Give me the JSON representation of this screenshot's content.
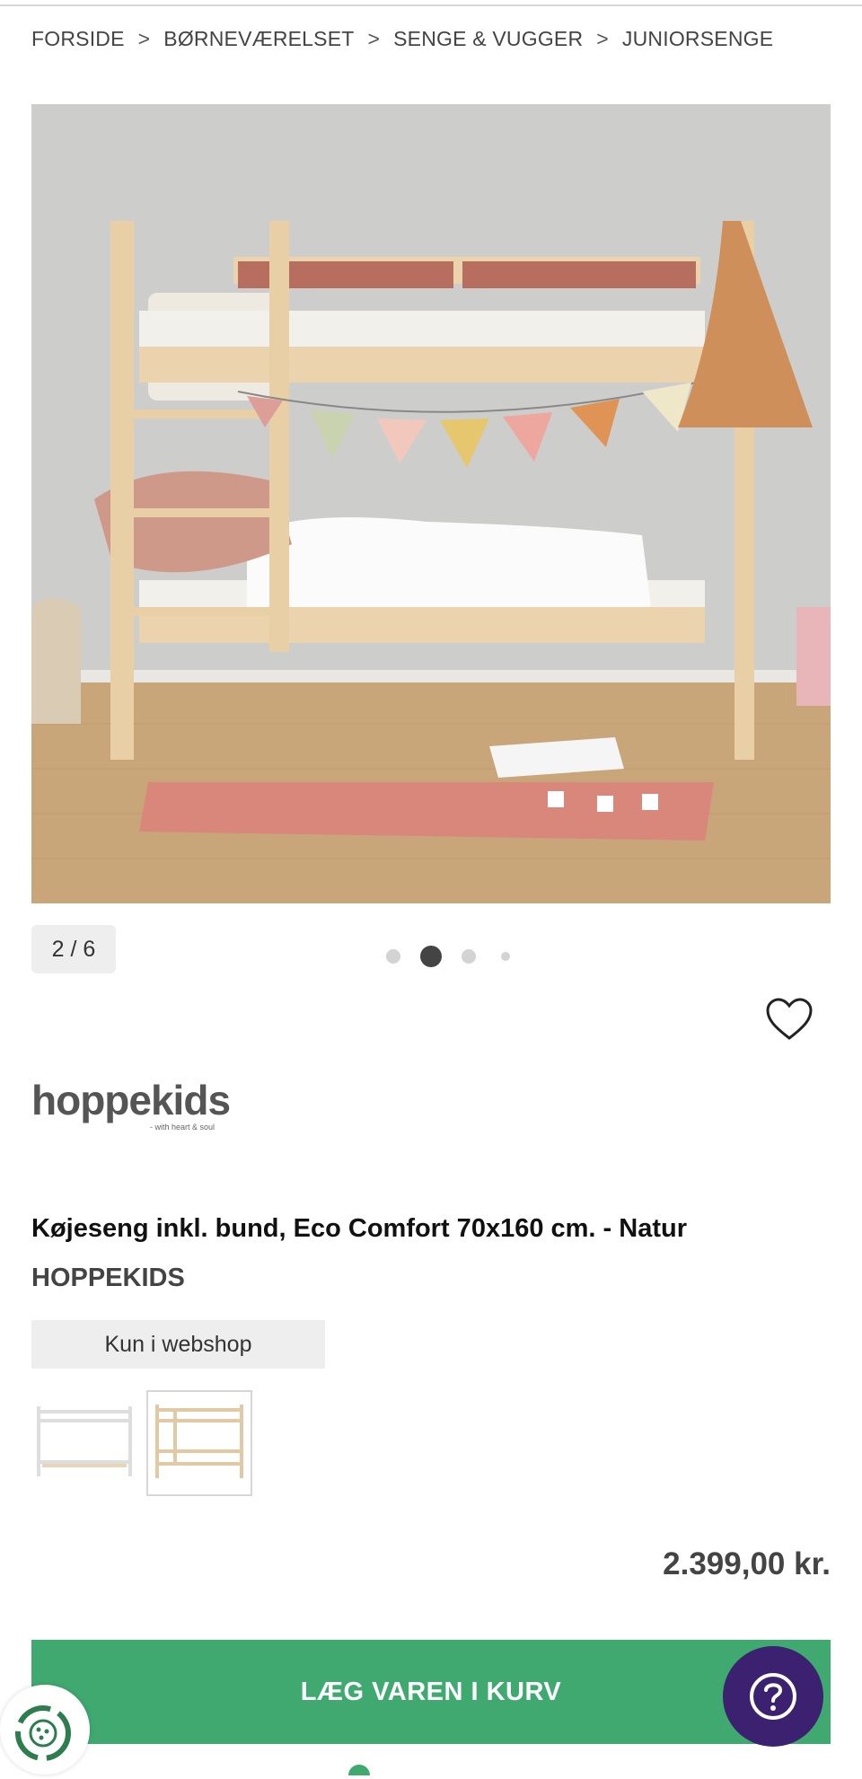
{
  "breadcrumb": {
    "items": [
      "FORSIDE",
      "BØRNEVÆRELSET",
      "SENGE & VUGGER",
      "JUNIORSENGE"
    ],
    "separator": ">"
  },
  "gallery": {
    "counter": "2 / 6",
    "current": 2,
    "total": 6
  },
  "product": {
    "brand_logo_text": "hoppekids",
    "brand_logo_tagline": "- with heart & soul",
    "title": "Køjeseng inkl. bund, Eco Comfort 70x160 cm. - Natur",
    "brand": "HOPPEKIDS",
    "badge": "Kun i webshop",
    "variants": [
      {
        "name": "Hvid",
        "selected": false
      },
      {
        "name": "Natur",
        "selected": true
      }
    ],
    "price": "2.399,00 kr."
  },
  "actions": {
    "add_to_cart": "LÆG VAREN I KURV"
  },
  "colors": {
    "cart_green": "#3fa970",
    "help_purple": "#3b2170",
    "badge_gray": "#eeeeee"
  },
  "icons": {
    "favorite": "heart-icon",
    "help": "question-icon",
    "eco": "recycle-icon"
  }
}
